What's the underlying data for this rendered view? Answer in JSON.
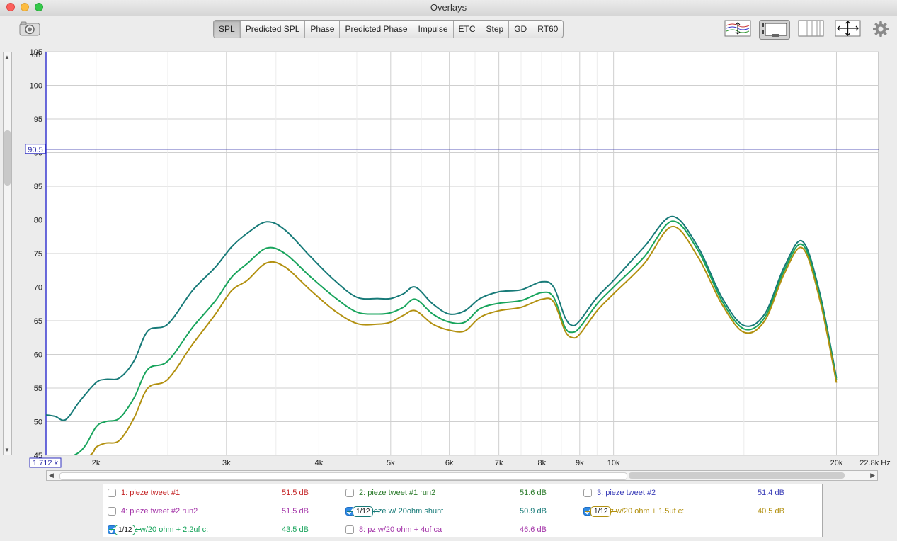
{
  "window": {
    "title": "Overlays"
  },
  "tabs": [
    {
      "label": "SPL",
      "active": true
    },
    {
      "label": "Predicted SPL",
      "active": false
    },
    {
      "label": "Phase",
      "active": false
    },
    {
      "label": "Predicted Phase",
      "active": false
    },
    {
      "label": "Impulse",
      "active": false
    },
    {
      "label": "ETC",
      "active": false
    },
    {
      "label": "Step",
      "active": false
    },
    {
      "label": "GD",
      "active": false
    },
    {
      "label": "RT60",
      "active": false
    }
  ],
  "toolbar_icons": [
    "camera-icon",
    "arrange-traces-icon",
    "limits-icon",
    "vertical-lines-icon",
    "fit-all-icon",
    "gear-icon"
  ],
  "chart_data": {
    "type": "line",
    "title": "",
    "xlabel": "Hz",
    "ylabel": "dB",
    "xscale": "log",
    "xlim": [
      1712,
      22800
    ],
    "ylim": [
      45,
      105
    ],
    "x_ticks": [
      {
        "v": 2000,
        "label": "2k"
      },
      {
        "v": 3000,
        "label": "3k"
      },
      {
        "v": 4000,
        "label": "4k"
      },
      {
        "v": 5000,
        "label": "5k"
      },
      {
        "v": 6000,
        "label": "6k"
      },
      {
        "v": 7000,
        "label": "7k"
      },
      {
        "v": 8000,
        "label": "8k"
      },
      {
        "v": 9000,
        "label": "9k"
      },
      {
        "v": 10000,
        "label": "10k"
      },
      {
        "v": 20000,
        "label": "20k"
      }
    ],
    "x_min_label": "1.712 k",
    "x_max_label": "22.8k Hz",
    "y_ticks": [
      45,
      50,
      55,
      60,
      65,
      70,
      75,
      80,
      85,
      90,
      95,
      100,
      105
    ],
    "cursor_level": 90.5,
    "cursor_label": "90.5",
    "grid": true,
    "series": [
      {
        "name": "5: pieze w/ 20ohm shunt",
        "color": "#177a78",
        "x": [
          1712,
          1760,
          1820,
          1900,
          2000,
          2060,
          2150,
          2250,
          2350,
          2500,
          2700,
          2900,
          3050,
          3200,
          3400,
          3600,
          3900,
          4200,
          4500,
          4800,
          5000,
          5200,
          5400,
          5700,
          6000,
          6300,
          6600,
          7000,
          7500,
          8000,
          8300,
          8600,
          8800,
          9000,
          9500,
          10000,
          11000,
          12000,
          13000,
          14000,
          15000,
          16000,
          17000,
          18000,
          19000,
          20000
        ],
        "y": [
          51.0,
          50.8,
          50.3,
          53.0,
          55.8,
          56.3,
          56.5,
          59.0,
          63.5,
          64.5,
          69.5,
          73.0,
          76.0,
          78.0,
          79.7,
          78.5,
          74.5,
          71.0,
          68.5,
          68.3,
          68.3,
          69.0,
          70.0,
          67.5,
          66.0,
          66.5,
          68.3,
          69.3,
          69.6,
          70.8,
          70.0,
          65.5,
          64.3,
          65.0,
          68.5,
          71.0,
          76.0,
          80.5,
          76.0,
          68.5,
          64.3,
          66.0,
          73.0,
          76.8,
          69.0,
          56.5
        ]
      },
      {
        "name": "7: pz w/20 ohm + 2.2uf c",
        "color": "#18a45c",
        "x": [
          1712,
          1900,
          2000,
          2060,
          2150,
          2250,
          2350,
          2500,
          2700,
          2900,
          3050,
          3200,
          3400,
          3600,
          3900,
          4200,
          4500,
          4800,
          5000,
          5200,
          5400,
          5700,
          6000,
          6300,
          6600,
          7000,
          7500,
          8000,
          8300,
          8600,
          8800,
          9000,
          9500,
          10000,
          11000,
          12000,
          13000,
          14000,
          15000,
          16000,
          17000,
          18000,
          19000,
          20000
        ],
        "y": [
          43.5,
          45.5,
          49.2,
          50.0,
          50.5,
          53.5,
          57.8,
          59.0,
          64.0,
          68.0,
          71.5,
          73.5,
          75.8,
          75.0,
          71.5,
          68.5,
          66.3,
          66.0,
          66.2,
          67.0,
          68.2,
          66.0,
          64.8,
          64.8,
          66.8,
          67.6,
          68.0,
          69.2,
          68.5,
          64.0,
          63.3,
          64.0,
          67.5,
          70.0,
          74.5,
          79.8,
          75.5,
          68.0,
          63.8,
          65.5,
          72.5,
          76.3,
          68.5,
          56.2
        ]
      },
      {
        "name": "6: pz w/20 ohm + 1.5uf c",
        "color": "#b2900f",
        "x": [
          1712,
          1950,
          2000,
          2060,
          2150,
          2250,
          2350,
          2500,
          2700,
          2900,
          3050,
          3200,
          3400,
          3600,
          3900,
          4200,
          4500,
          4800,
          5000,
          5200,
          5400,
          5700,
          6000,
          6300,
          6600,
          7000,
          7500,
          8000,
          8300,
          8600,
          8800,
          9000,
          9500,
          10000,
          11000,
          12000,
          13000,
          14000,
          15000,
          16000,
          17000,
          18000,
          19000,
          20000
        ],
        "y": [
          42.0,
          44.8,
          46.2,
          46.8,
          47.2,
          50.5,
          55.0,
          56.3,
          61.5,
          66.0,
          69.5,
          71.0,
          73.6,
          73.0,
          69.5,
          66.5,
          64.6,
          64.5,
          64.8,
          65.8,
          66.5,
          64.5,
          63.6,
          63.5,
          65.5,
          66.5,
          67.0,
          68.2,
          67.8,
          63.5,
          62.5,
          63.0,
          66.5,
          69.0,
          73.5,
          79.0,
          74.5,
          67.5,
          63.3,
          65.0,
          72.0,
          75.8,
          68.0,
          55.8
        ]
      }
    ]
  },
  "legend": [
    {
      "label": "1: pieze tweet #1",
      "value": "51.5 dB",
      "color": "#c42325",
      "checked": false,
      "smoothing": ""
    },
    {
      "label": "2: pieze tweet #1 run2",
      "value": "51.6 dB",
      "color": "#2a7a2a",
      "checked": false,
      "smoothing": ""
    },
    {
      "label": "3: pieze tweet #2",
      "value": "51.4 dB",
      "color": "#3b3eb8",
      "checked": false,
      "smoothing": ""
    },
    {
      "label": "4: pieze tweet #2 run2",
      "value": "51.5 dB",
      "color": "#a333a8",
      "checked": false,
      "smoothing": ""
    },
    {
      "label": "5: pieze w/ 20ohm shunt",
      "value": "50.9 dB",
      "color": "#177a78",
      "checked": true,
      "smoothing": "1/12"
    },
    {
      "label": "6: pz w/20 ohm + 1.5uf c:",
      "value": "40.5 dB",
      "color": "#b2900f",
      "checked": true,
      "smoothing": "1/12"
    },
    {
      "label": "7: pz w/20 ohm + 2.2uf c:",
      "value": "43.5 dB",
      "color": "#18a45c",
      "checked": true,
      "smoothing": "1/12"
    },
    {
      "label": "8: pz w/20 ohm + 4uf ca",
      "value": "46.6 dB",
      "color": "#a333a8",
      "checked": false,
      "smoothing": ""
    }
  ]
}
